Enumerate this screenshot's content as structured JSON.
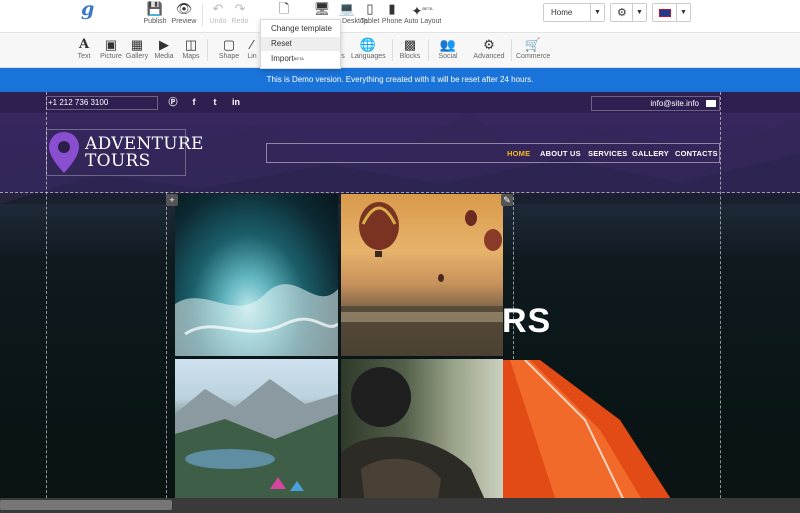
{
  "topbar": {
    "logo_letter": "g",
    "publish_label": "Publish",
    "preview_label": "Preview",
    "undo_label": "Undo",
    "redo_label": "Redo",
    "desktop_label": "Desktop",
    "tablet_label": "Tablet",
    "phone_label": "Phone",
    "autolayout_label": "Auto Layout",
    "autolayout_badge": "BETA",
    "page_select": "Home",
    "accent_color": "#1a73d9"
  },
  "file_menu": {
    "items": [
      {
        "label": "Change template"
      },
      {
        "label": "Reset"
      },
      {
        "label": "Import",
        "badge": "BETA"
      }
    ]
  },
  "elembar": {
    "items": [
      {
        "label": "Text",
        "icon": "text-icon"
      },
      {
        "label": "Picture",
        "icon": "picture-icon"
      },
      {
        "label": "Gallery",
        "icon": "gallery-icon"
      },
      {
        "label": "Media",
        "icon": "media-icon"
      },
      {
        "label": "Maps",
        "icon": "maps-icon"
      },
      {
        "label": "Shape",
        "icon": "shape-icon"
      },
      {
        "label": "Lin",
        "icon": "line-icon"
      },
      {
        "label": "s",
        "icon": "forms-icon"
      },
      {
        "label": "Languages",
        "icon": "languages-icon"
      },
      {
        "label": "Blocks",
        "icon": "blocks-icon"
      },
      {
        "label": "Social",
        "icon": "social-icon"
      },
      {
        "label": "Advanced",
        "icon": "advanced-icon"
      },
      {
        "label": "Commerce",
        "icon": "commerce-icon"
      }
    ]
  },
  "banner": {
    "text": "This is Demo version. Everything created with it will be reset after 24 hours."
  },
  "site": {
    "phone": "+1 212 736 3100",
    "email": "info@site.info",
    "logo_line1": "ADVENTURE",
    "logo_line2": "TOURS",
    "nav": [
      "HOME",
      "ABOUT US",
      "SERVICES",
      "GALLERY",
      "CONTACTS"
    ],
    "active_nav_color": "#f5b621",
    "hero_text_fragment": "RS"
  }
}
